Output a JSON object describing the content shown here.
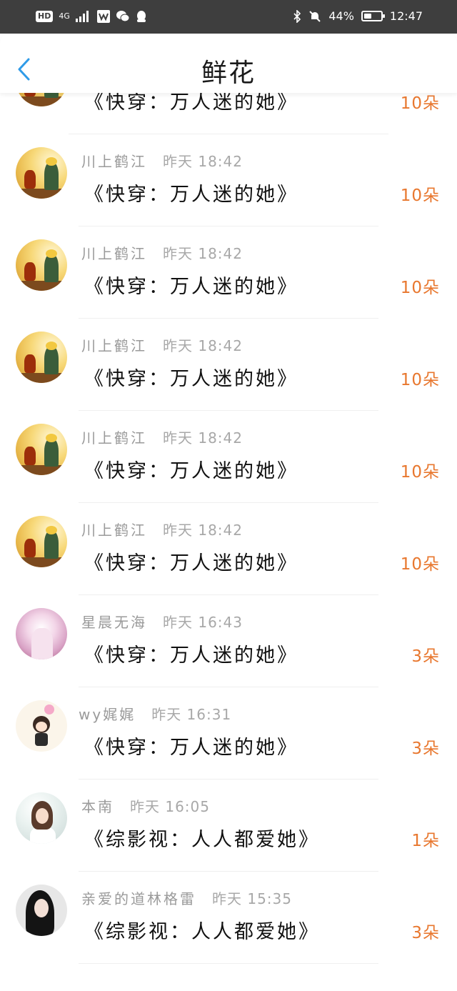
{
  "status_bar": {
    "hd": "HD",
    "signal": "4G",
    "battery_percent": "44%",
    "battery_level": 0.44,
    "time": "12:47"
  },
  "header": {
    "title": "鲜花"
  },
  "items": [
    {
      "avatar": "little-prince",
      "name": "",
      "time": "",
      "book": "《快穿：万人迷的她》",
      "count": "10朵"
    },
    {
      "avatar": "little-prince",
      "name": "川上鹤江",
      "time": "昨天 18:42",
      "book": "《快穿：万人迷的她》",
      "count": "10朵"
    },
    {
      "avatar": "little-prince",
      "name": "川上鹤江",
      "time": "昨天 18:42",
      "book": "《快穿：万人迷的她》",
      "count": "10朵"
    },
    {
      "avatar": "little-prince",
      "name": "川上鹤江",
      "time": "昨天 18:42",
      "book": "《快穿：万人迷的她》",
      "count": "10朵"
    },
    {
      "avatar": "little-prince",
      "name": "川上鹤江",
      "time": "昨天 18:42",
      "book": "《快穿：万人迷的她》",
      "count": "10朵"
    },
    {
      "avatar": "little-prince",
      "name": "川上鹤江",
      "time": "昨天 18:42",
      "book": "《快穿：万人迷的她》",
      "count": "10朵"
    },
    {
      "avatar": "girl-pink",
      "name": "星晨无海",
      "time": "昨天 16:43",
      "book": "《快穿：万人迷的她》",
      "count": "3朵"
    },
    {
      "avatar": "chibi",
      "name": "wy娓娓",
      "time": "昨天 16:31",
      "book": "《快穿：万人迷的她》",
      "count": "3朵"
    },
    {
      "avatar": "girl-white",
      "name": "本南",
      "time": "昨天 16:05",
      "book": "《综影视：人人都爱她》",
      "count": "1朵"
    },
    {
      "avatar": "girl-dark",
      "name": "亲爱的道林格雷",
      "time": "昨天 15:35",
      "book": "《综影视：人人都爱她》",
      "count": "3朵"
    }
  ],
  "colors": {
    "accent": "#e8772e",
    "back_arrow": "#2f9be8",
    "status_bg": "#3e3e3e"
  }
}
